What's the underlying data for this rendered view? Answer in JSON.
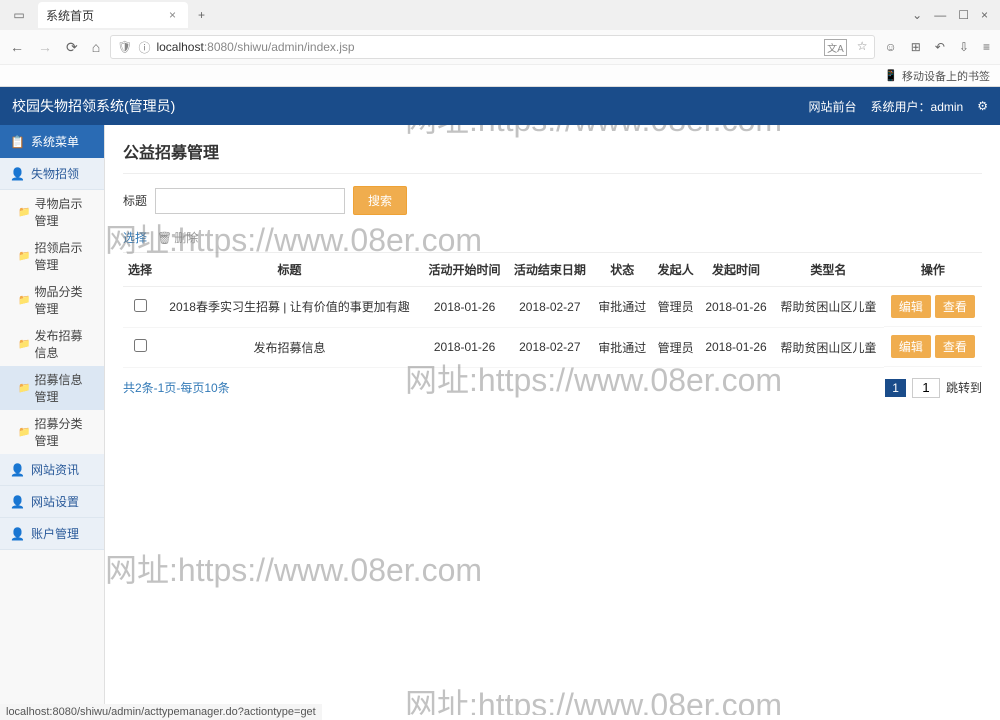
{
  "browser": {
    "tab_title": "系统首页",
    "url_host": "localhost",
    "url_port": ":8080",
    "url_path": "/shiwu/admin/index.jsp",
    "bookmark": "移动设备上的书签",
    "status_bar": "localhost:8080/shiwu/admin/acttypemanager.do?actiontype=get"
  },
  "header": {
    "title": "校园失物招领系统(管理员)",
    "front_site": "网站前台",
    "user_label": "系统用户：",
    "user_name": "admin"
  },
  "sidebar": {
    "menu_head": "系统菜单",
    "cat1": "失物招领",
    "items1": [
      "寻物启示管理",
      "招领启示管理",
      "物品分类管理",
      "发布招募信息",
      "招募信息管理",
      "招募分类管理"
    ],
    "active_index": 4,
    "cat2": "网站资讯",
    "cat3": "网站设置",
    "cat4": "账户管理"
  },
  "page": {
    "title": "公益招募管理",
    "search_label": "标题",
    "search_btn": "搜索",
    "select_link": "选择",
    "delete_link": "删除"
  },
  "table": {
    "cols": [
      "选择",
      "标题",
      "活动开始时间",
      "活动结束日期",
      "状态",
      "发起人",
      "发起时间",
      "类型名",
      "操作"
    ],
    "rows": [
      {
        "title": "2018春季实习生招募 | 让有价值的事更加有趣",
        "start": "2018-01-26",
        "end": "2018-02-27",
        "status": "审批通过",
        "owner": "管理员",
        "created": "2018-01-26",
        "type": "帮助贫困山区儿童"
      },
      {
        "title": "发布招募信息",
        "start": "2018-01-26",
        "end": "2018-02-27",
        "status": "审批通过",
        "owner": "管理员",
        "created": "2018-01-26",
        "type": "帮助贫困山区儿童"
      }
    ],
    "edit_btn": "编辑",
    "view_btn": "查看"
  },
  "pager": {
    "info": "共2条-1页-每页10条",
    "current": "1",
    "goto_val": "1",
    "jump": "跳转到"
  },
  "watermark": "网址:https://www.08er.com"
}
